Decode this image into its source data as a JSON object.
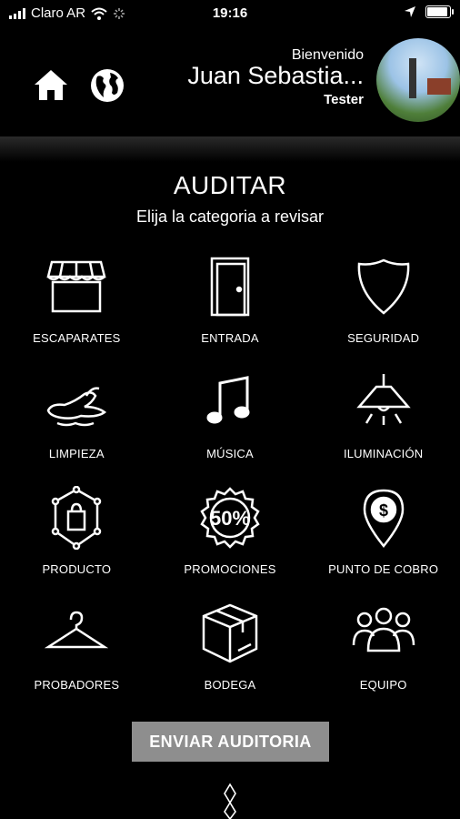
{
  "status_bar": {
    "carrier": "Claro AR",
    "time": "19:16",
    "icons": [
      "signal-icon",
      "wifi-icon",
      "loading-icon",
      "location-icon",
      "battery-icon"
    ]
  },
  "header": {
    "welcome": "Bienvenido",
    "user_name": "Juan Sebastia...",
    "role": "Tester"
  },
  "main": {
    "title": "AUDITAR",
    "subtitle": "Elija la categoria a revisar",
    "categories": [
      {
        "label": "ESCAPARATES",
        "icon": "storefront-icon"
      },
      {
        "label": "ENTRADA",
        "icon": "door-icon"
      },
      {
        "label": "SEGURIDAD",
        "icon": "shield-icon"
      },
      {
        "label": "LIMPIEZA",
        "icon": "mop-icon"
      },
      {
        "label": "MÚSICA",
        "icon": "music-note-icon"
      },
      {
        "label": "ILUMINACIÓN",
        "icon": "lamp-icon"
      },
      {
        "label": "PRODUCTO",
        "icon": "product-bag-icon"
      },
      {
        "label": "PROMOCIONES",
        "icon": "discount-badge-icon"
      },
      {
        "label": "PUNTO DE COBRO",
        "icon": "payment-pin-icon"
      },
      {
        "label": "PROBADORES",
        "icon": "hanger-icon"
      },
      {
        "label": "BODEGA",
        "icon": "box-icon"
      },
      {
        "label": "EQUIPO",
        "icon": "team-icon"
      }
    ],
    "send_button": "ENVIAR AUDITORIA"
  },
  "colors": {
    "background": "#000000",
    "text": "#ffffff",
    "button": "#8e8e8e"
  }
}
